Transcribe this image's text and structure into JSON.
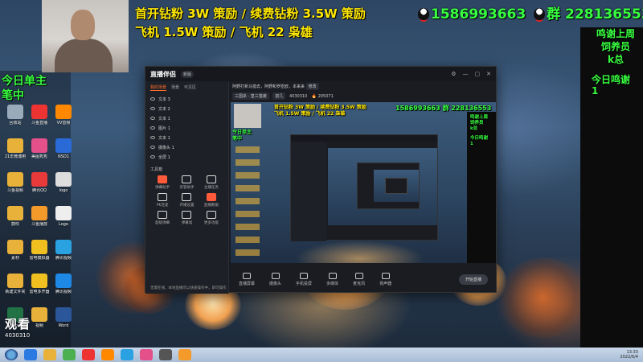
{
  "overlay": {
    "line1": "首开钻粉 3W 策励 / 续费钻粉 3.5W 策励",
    "line2": "飞机 1.5W 策励 / 飞机 22 枭雄",
    "qq1": "1586993663",
    "qq2_prefix": "群",
    "qq2": "228136553",
    "thanks_lines": [
      "鸣谢上周",
      "饲养员",
      "k总"
    ],
    "today_thanks": "今日鸣谢",
    "today_thanks_count": "1",
    "today_host_line1": "今日单主",
    "today_host_line2": "笔中"
  },
  "desktop_icons": [
    {
      "label": "回收站",
      "color": "#9ab"
    },
    {
      "label": "斗鱼直播",
      "color": "#e33"
    },
    {
      "label": "VV音频",
      "color": "#f80"
    },
    {
      "label": "21年微博用",
      "color": "#e8b23a"
    },
    {
      "label": "美图秀秀",
      "color": "#e4508a"
    },
    {
      "label": "NSO1",
      "color": "#2a6ad6"
    },
    {
      "label": "斗鱼视频",
      "color": "#e8b23a"
    },
    {
      "label": "腾讯QQ",
      "color": "#e83a3a"
    },
    {
      "label": "logo",
      "color": "#ddd"
    },
    {
      "label": "鼓吹",
      "color": "#e8b23a"
    },
    {
      "label": "斗鱼播放",
      "color": "#f49a2a"
    },
    {
      "label": "Logo",
      "color": "#eee"
    },
    {
      "label": "素材",
      "color": "#e8b23a"
    },
    {
      "label": "雷电模拟器",
      "color": "#f0c020"
    },
    {
      "label": "腾讯视频",
      "color": "#2aa1e0"
    },
    {
      "label": "新建文件夹",
      "color": "#e8b23a"
    },
    {
      "label": "雷电多开器",
      "color": "#f0c020"
    },
    {
      "label": "腾讯视频",
      "color": "#1e88e5"
    },
    {
      "label": "Excel",
      "color": "#217346"
    },
    {
      "label": "视频",
      "color": "#e8b23a"
    },
    {
      "label": "Word",
      "color": "#2b579a"
    }
  ],
  "stats": {
    "label": "观看",
    "count": "4030310"
  },
  "app": {
    "logo": "直播伴侣",
    "version_badge": "新版",
    "tabs": [
      "我的场景",
      "场景",
      "可见区"
    ],
    "scenes": [
      "文本 3",
      "文本 2",
      "文本 1",
      "图片 1",
      "文本 1",
      "摄像头 1",
      "全屏 1"
    ],
    "tools_title": "工具箱",
    "tools": [
      {
        "label": "弹幕助手",
        "red": true
      },
      {
        "label": "房管助手",
        "red": false
      },
      {
        "label": "主播任务",
        "red": false
      },
      {
        "label": "PK连麦",
        "red": false
      },
      {
        "label": "开播设置",
        "red": false
      },
      {
        "label": "直播数据",
        "red": true
      },
      {
        "label": "超级弹幕",
        "red": false
      },
      {
        "label": "弹幕墙",
        "red": false
      },
      {
        "label": "更多功能",
        "red": false
      }
    ],
    "footer_note": "无需在线，本地直播可以快速操作中，即可操作",
    "topinfo_title": "阿野打新马猎去，阿野和罗密欧，本来来",
    "topinfo_tag": "修改",
    "topinfo_tags": [
      "三国杀 · 皇三猎袭",
      "前几"
    ],
    "topinfo_id": "4030310",
    "topinfo_hot": "205071",
    "bottom_items": [
      "直播屏幕",
      "摄像头",
      "手机投屏",
      "多媒体",
      "麦克风",
      "扬声器"
    ],
    "start_button": "开始直播"
  },
  "clock": {
    "time": "13:33",
    "date": "2022/6/4"
  }
}
